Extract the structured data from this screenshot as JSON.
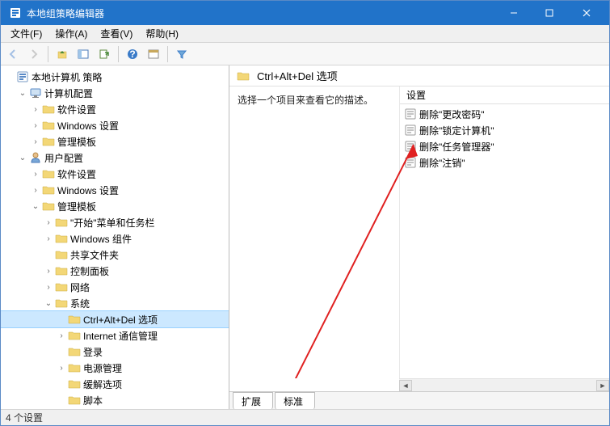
{
  "window": {
    "title": "本地组策略编辑器"
  },
  "menubar": {
    "file": "文件(F)",
    "action": "操作(A)",
    "view": "查看(V)",
    "help": "帮助(H)"
  },
  "tree": {
    "root": "本地计算机 策略",
    "computer": "计算机配置",
    "comp_software": "软件设置",
    "comp_windows": "Windows 设置",
    "comp_templates": "管理模板",
    "user": "用户配置",
    "user_software": "软件设置",
    "user_windows": "Windows 设置",
    "user_templates": "管理模板",
    "start_taskbar": "\"开始\"菜单和任务栏",
    "win_components": "Windows 组件",
    "shared_folders": "共享文件夹",
    "control_panel": "控制面板",
    "network": "网络",
    "system": "系统",
    "ctrl_alt_del": "Ctrl+Alt+Del 选项",
    "internet_mgmt": "Internet 通信管理",
    "login": "登录",
    "power_mgmt": "电源管理",
    "mitigation": "缓解选项",
    "scripts": "脚本"
  },
  "content": {
    "header_title": "Ctrl+Alt+Del 选项",
    "description": "选择一个项目来查看它的描述。",
    "col_setting": "设置",
    "items": [
      "删除\"更改密码\"",
      "删除\"锁定计算机\"",
      "删除\"任务管理器\"",
      "删除\"注销\""
    ],
    "tabs": {
      "extended": "扩展",
      "standard": "标准"
    }
  },
  "status": "4 个设置"
}
